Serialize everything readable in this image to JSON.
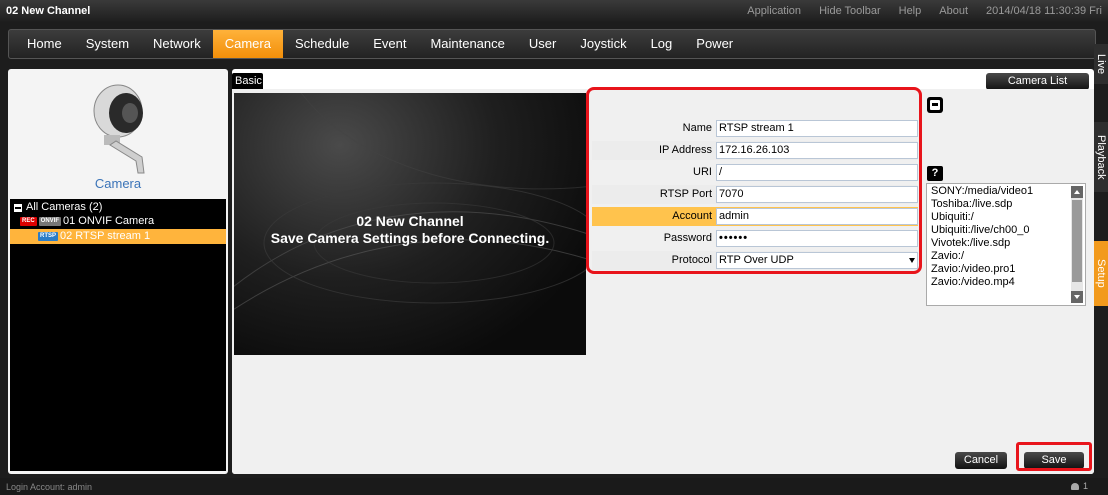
{
  "window": {
    "title": "02 New Channel",
    "toplinks": [
      "Application",
      "Hide Toolbar",
      "Help",
      "About",
      "2014/04/18 11:30:39 Fri"
    ]
  },
  "menu": {
    "items": [
      "Home",
      "System",
      "Network",
      "Camera",
      "Schedule",
      "Event",
      "Maintenance",
      "User",
      "Joystick",
      "Log",
      "Power"
    ],
    "active": "Camera"
  },
  "sidetabs": {
    "live": "Live",
    "playback": "Playback",
    "setup": "Setup"
  },
  "left": {
    "camera_label": "Camera",
    "tree": {
      "root": "All Cameras (2)",
      "cameras": [
        {
          "label": "01   ONVIF Camera",
          "badges": [
            "REC",
            "ONVIF"
          ]
        },
        {
          "label": "02   RTSP stream 1",
          "badges": [
            "RTSP"
          ]
        }
      ]
    }
  },
  "main": {
    "tab_label": "Basic",
    "camera_list_button": "Camera List",
    "preview": {
      "line1": "02 New Channel",
      "line2": "Save Camera Settings before Connecting."
    },
    "form": {
      "name": {
        "label": "Name",
        "value": "RTSP stream 1"
      },
      "ip": {
        "label": "IP Address",
        "value": "172.16.26.103"
      },
      "uri": {
        "label": "URI",
        "value": "/"
      },
      "rtsp_port": {
        "label": "RTSP Port",
        "value": "7070"
      },
      "account": {
        "label": "Account",
        "value": "admin"
      },
      "password": {
        "label": "Password",
        "value": "••••••"
      },
      "protocol": {
        "label": "Protocol",
        "value": "RTP Over UDP"
      }
    },
    "help_glyph": "?",
    "uri_presets": [
      "SONY:/media/video1",
      "Toshiba:/live.sdp",
      "Ubiquiti:/",
      "Ubiquiti:/live/ch00_0",
      "Vivotek:/live.sdp",
      "Zavio:/",
      "Zavio:/video.pro1",
      "Zavio:/video.mp4"
    ],
    "cancel_button": "Cancel",
    "save_button": "Save"
  },
  "status": {
    "login": "Login Account: admin",
    "users": "1"
  },
  "colors": {
    "accent": "#f7a21f",
    "highlight_box": "#e8141b",
    "link_blue": "#3b74b8"
  }
}
